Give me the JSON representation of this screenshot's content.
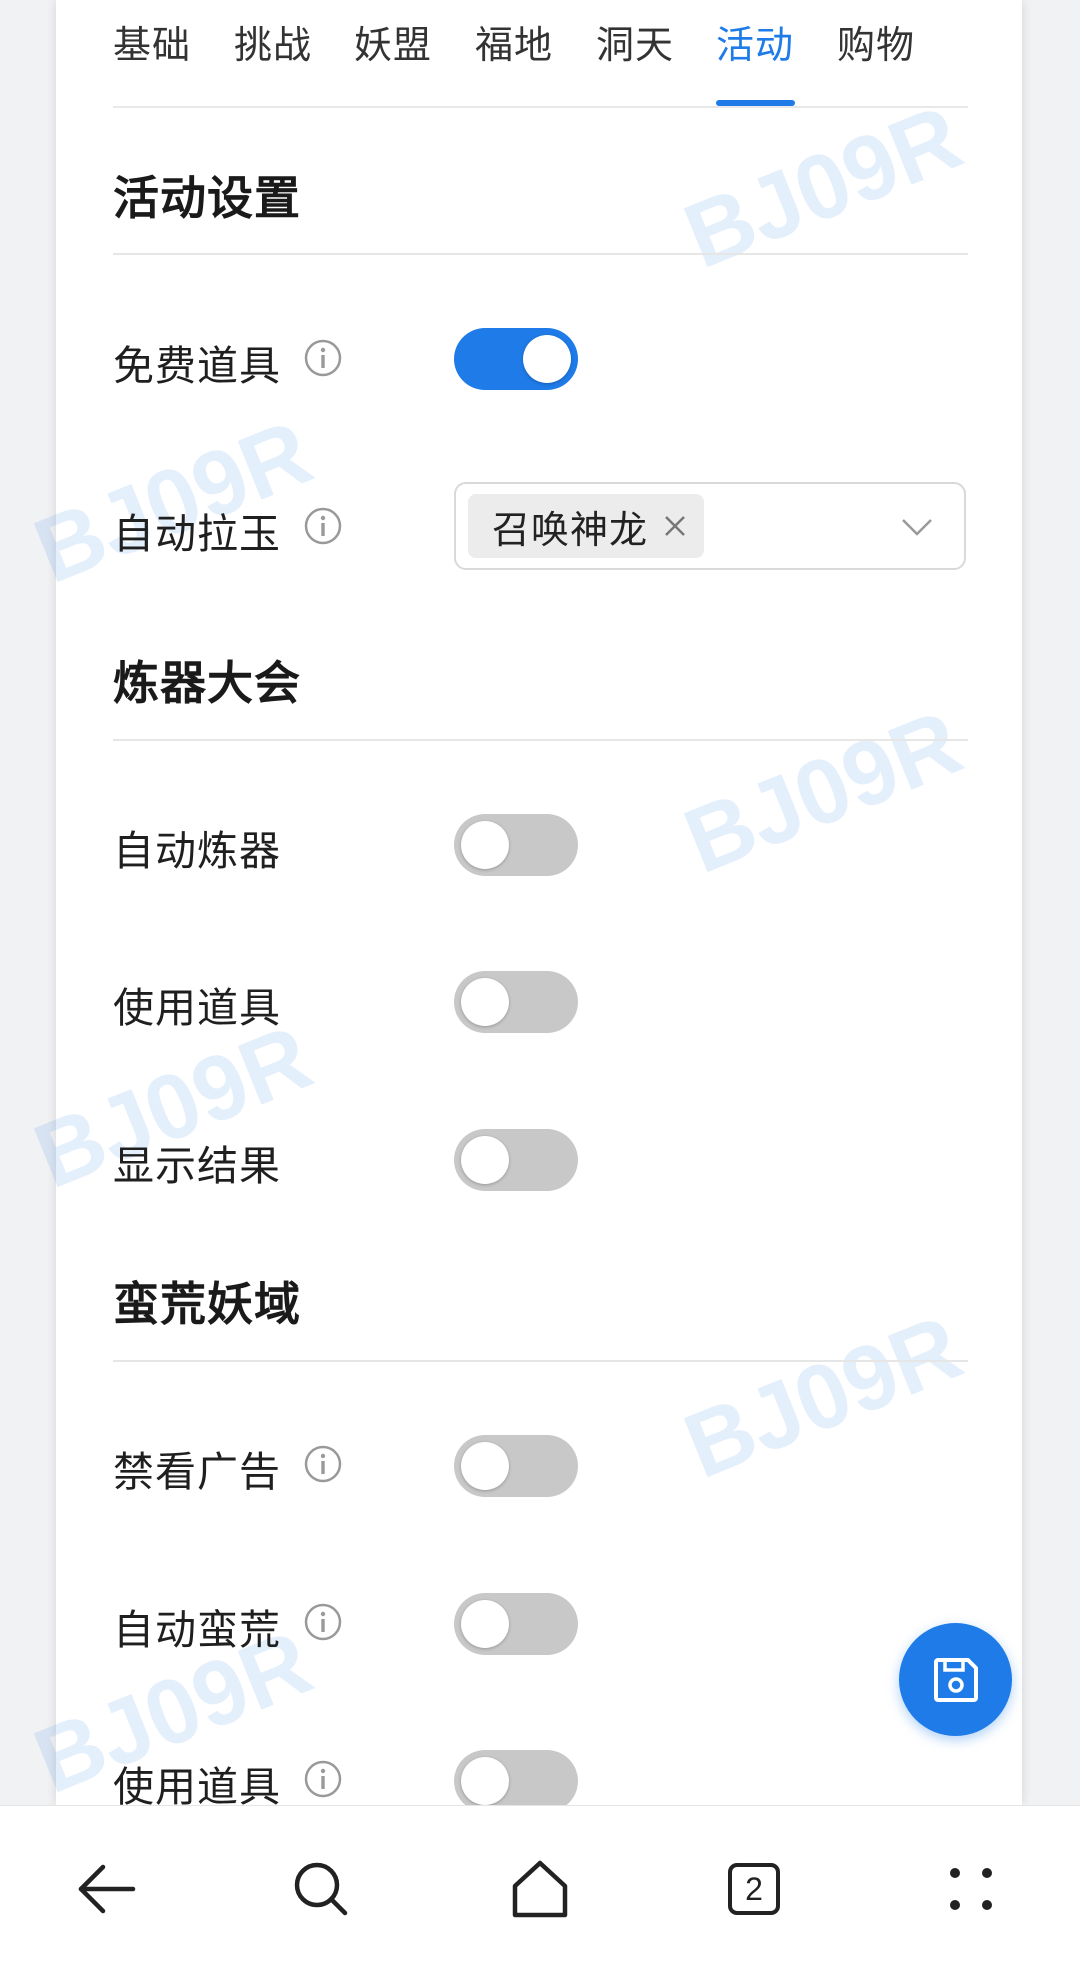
{
  "tabs": [
    {
      "label": "基础",
      "active": false
    },
    {
      "label": "挑战",
      "active": false
    },
    {
      "label": "妖盟",
      "active": false
    },
    {
      "label": "福地",
      "active": false
    },
    {
      "label": "洞天",
      "active": false
    },
    {
      "label": "活动",
      "active": true
    },
    {
      "label": "购物",
      "active": false
    }
  ],
  "sections": {
    "activity": {
      "title": "活动设置",
      "free_items": {
        "label": "免费道具",
        "enabled": true
      },
      "auto_gacha": {
        "label": "自动拉玉",
        "selected_chip": "召唤神龙"
      }
    },
    "forge": {
      "title": "炼器大会",
      "auto_forge": {
        "label": "自动炼器",
        "enabled": false
      },
      "use_items": {
        "label": "使用道具",
        "enabled": false
      },
      "show_results": {
        "label": "显示结果",
        "enabled": false
      }
    },
    "wild": {
      "title": "蛮荒妖域",
      "block_ads": {
        "label": "禁看广告",
        "enabled": false
      },
      "auto_wild": {
        "label": "自动蛮荒",
        "enabled": false
      },
      "use_items": {
        "label": "使用道具",
        "enabled": false
      }
    }
  },
  "watermark": "BJ09R",
  "nav": {
    "tab_count": "2",
    "icons": [
      "back-arrow-icon",
      "search-icon",
      "home-icon",
      "tabs-icon",
      "more-icon"
    ]
  },
  "colors": {
    "accent": "#1e7be8",
    "toggle_off": "#c8c8c8"
  }
}
